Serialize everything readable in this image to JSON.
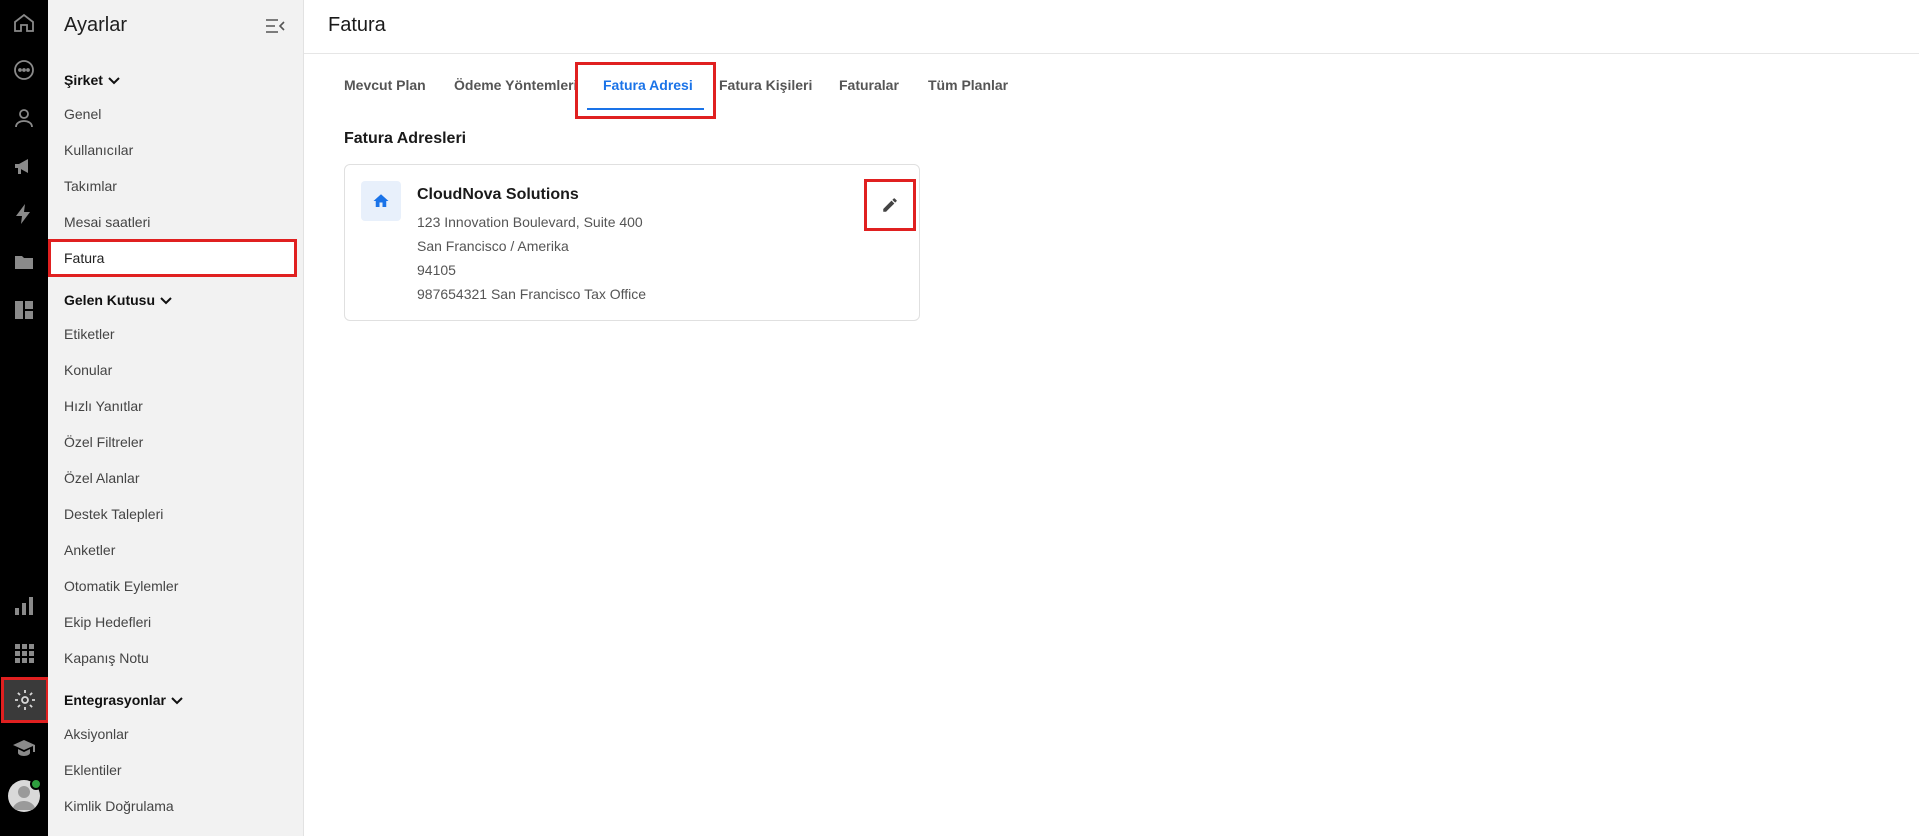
{
  "sidebar": {
    "title": "Ayarlar",
    "sections": [
      {
        "label": "Şirket",
        "items": [
          "Genel",
          "Kullanıcılar",
          "Takımlar",
          "Mesai saatleri",
          "Fatura"
        ]
      },
      {
        "label": "Gelen Kutusu",
        "items": [
          "Etiketler",
          "Konular",
          "Hızlı Yanıtlar",
          "Özel Filtreler",
          "Özel Alanlar",
          "Destek Talepleri",
          "Anketler",
          "Otomatik Eylemler",
          "Ekip Hedefleri",
          "Kapanış Notu"
        ]
      },
      {
        "label": "Entegrasyonlar",
        "items": [
          "Aksiyonlar",
          "Eklentiler",
          "Kimlik Doğrulama"
        ]
      }
    ]
  },
  "header": {
    "title": "Fatura"
  },
  "tabs": [
    "Mevcut Plan",
    "Ödeme Yöntemleri",
    "Fatura Adresi",
    "Fatura Kişileri",
    "Faturalar",
    "Tüm Planlar"
  ],
  "active_tab": "Fatura Adresi",
  "section_title": "Fatura Adresleri",
  "address_card": {
    "company": "CloudNova Solutions",
    "street": "123 Innovation Boulevard, Suite 400",
    "city_country": "San Francisco / Amerika",
    "postal_code": "94105",
    "tax_info": "987654321 San Francisco Tax Office"
  },
  "colors": {
    "accent": "#1a73e8",
    "highlight": "#e02020",
    "rail_bg": "#000000",
    "sidebar_bg": "#f2f2f2"
  },
  "icons": [
    "home-icon",
    "chat-icon",
    "user-icon",
    "megaphone-icon",
    "bolt-icon",
    "folder-icon",
    "dashboard-icon",
    "bar-chart-icon",
    "apps-grid-icon",
    "gear-icon",
    "graduation-cap-icon",
    "pencil-icon",
    "collapse-menu-icon",
    "chevron-down-icon"
  ]
}
